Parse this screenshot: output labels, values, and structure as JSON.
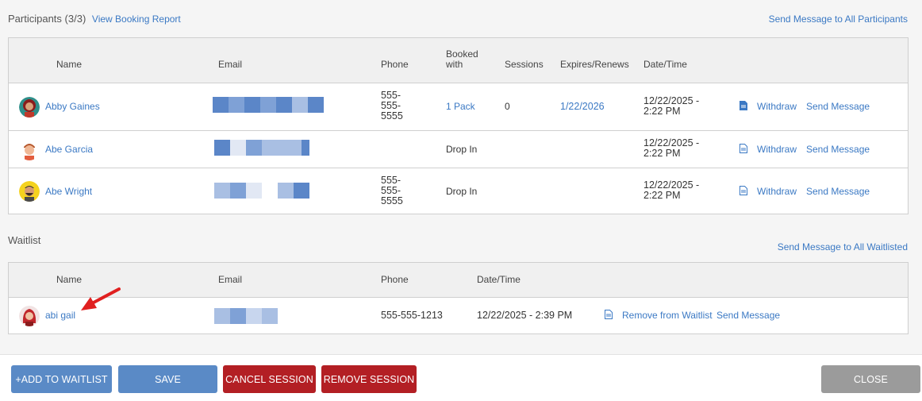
{
  "participants": {
    "title": "Participants",
    "count": "(3/3)",
    "report_link": "View Booking Report",
    "message_all": "Send Message to All Participants",
    "headers": {
      "name": "Name",
      "email": "Email",
      "phone": "Phone",
      "booked_with_1": "Booked",
      "booked_with_2": "with",
      "sessions": "Sessions",
      "expires": "Expires/Renews",
      "datetime": "Date/Time"
    },
    "rows": [
      {
        "name": "Abby Gaines",
        "phone_1": "555-",
        "phone_2": "555-",
        "phone_3": "5555",
        "booked_with": "1 Pack",
        "sessions": "0",
        "expires": "1/22/2026",
        "date_1": "12/22/2025 -",
        "date_2": "2:22 PM",
        "withdraw": "Withdraw",
        "send": "Send Message"
      },
      {
        "name": "Abe Garcia",
        "phone_1": "",
        "phone_2": "",
        "phone_3": "",
        "booked_with": "Drop In",
        "sessions": "",
        "expires": "",
        "date_1": "12/22/2025 -",
        "date_2": "2:22 PM",
        "withdraw": "Withdraw",
        "send": "Send Message"
      },
      {
        "name": "Abe Wright",
        "phone_1": "555-",
        "phone_2": "555-",
        "phone_3": "5555",
        "booked_with": "Drop In",
        "sessions": "",
        "expires": "",
        "date_1": "12/22/2025 -",
        "date_2": "2:22 PM",
        "withdraw": "Withdraw",
        "send": "Send Message"
      }
    ]
  },
  "waitlist": {
    "title": "Waitlist",
    "message_all": "Send Message to All Waitlisted",
    "headers": {
      "name": "Name",
      "email": "Email",
      "phone": "Phone",
      "datetime": "Date/Time"
    },
    "rows": [
      {
        "name": "abi gail",
        "phone": "555-555-1213",
        "datetime": "12/22/2025 - 2:39 PM",
        "remove": "Remove from Waitlist",
        "send": "Send Message"
      }
    ]
  },
  "footer": {
    "add_waitlist": "+ADD TO WAITLIST",
    "save": "SAVE",
    "cancel_session": "CANCEL SESSION",
    "remove_session": "REMOVE SESSION",
    "close": "CLOSE"
  },
  "colors": {
    "link": "#3b79c4",
    "primary": "#5a8ac6",
    "danger": "#b31f24",
    "neutral": "#9b9b9b",
    "annotation": "#e02020"
  }
}
